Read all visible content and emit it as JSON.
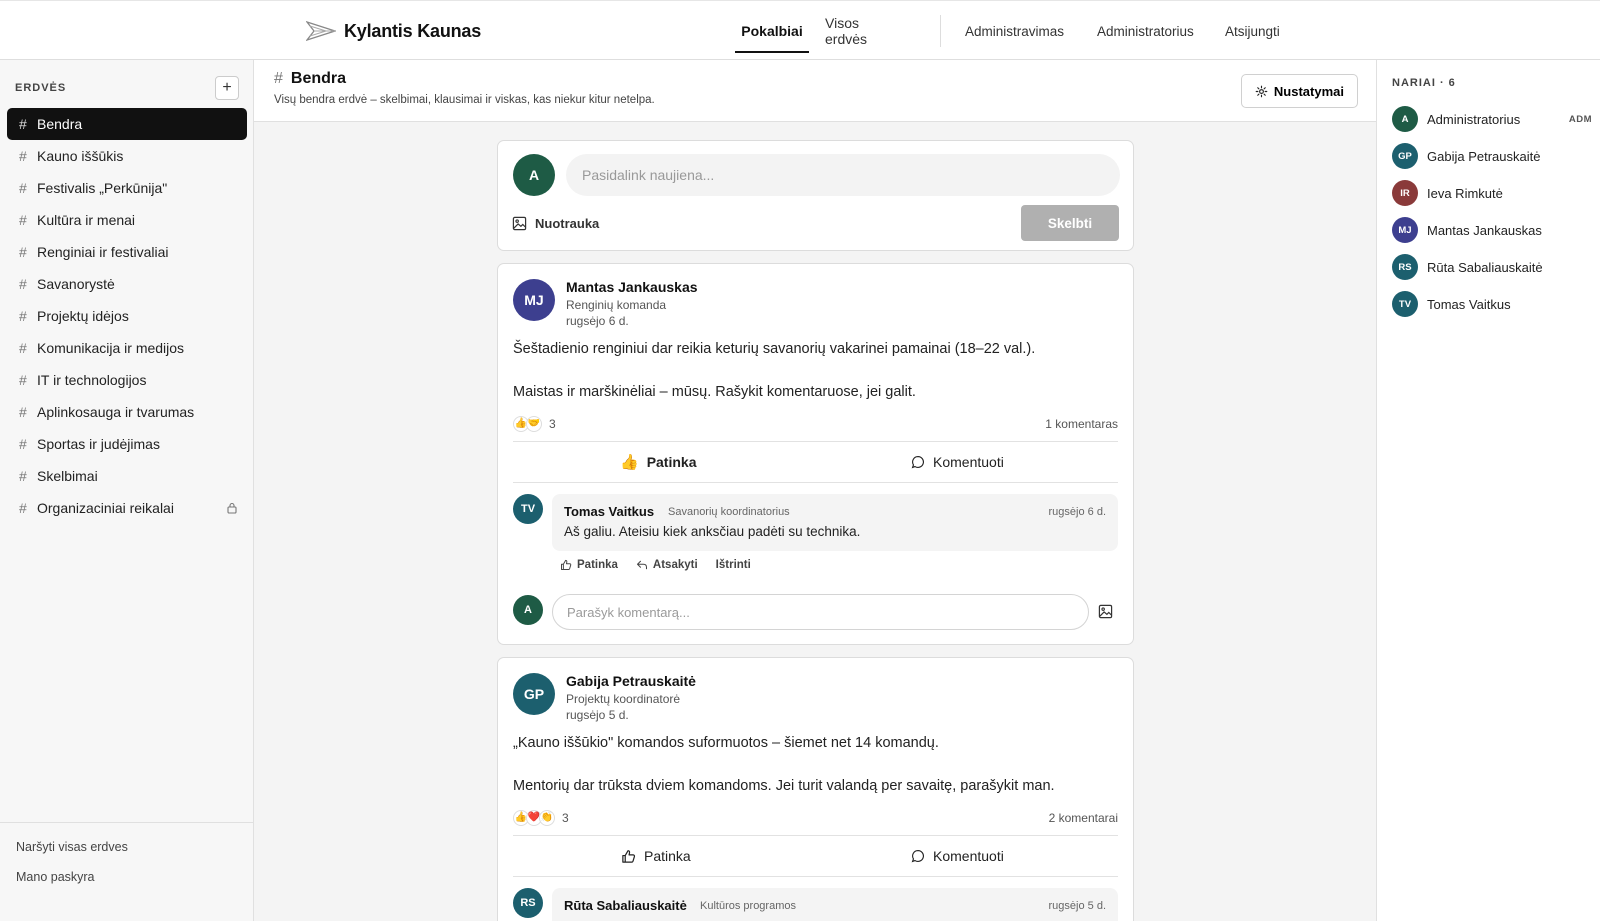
{
  "brand": {
    "name": "Kylantis Kaunas"
  },
  "nav": {
    "tabs": [
      {
        "label": "Pokalbiai",
        "active": true
      },
      {
        "label": "Visos erdvės",
        "active": false
      }
    ],
    "links": [
      "Administravimas",
      "Administratorius",
      "Atsijungti"
    ]
  },
  "sidebar": {
    "title": "ERDVĖS",
    "add_label": "+",
    "channels": [
      {
        "name": "Bendra",
        "active": true
      },
      {
        "name": "Kauno iššūkis"
      },
      {
        "name": "Festivalis „Perkūnija\""
      },
      {
        "name": "Kultūra ir menai"
      },
      {
        "name": "Renginiai ir festivaliai"
      },
      {
        "name": "Savanorystė"
      },
      {
        "name": "Projektų idėjos"
      },
      {
        "name": "Komunikacija ir medijos"
      },
      {
        "name": "IT ir technologijos"
      },
      {
        "name": "Aplinkosauga ir tvarumas"
      },
      {
        "name": "Sportas ir judėjimas"
      },
      {
        "name": "Skelbimai"
      },
      {
        "name": "Organizaciniai reikalai",
        "locked": true
      }
    ],
    "footer": {
      "browse": "Naršyti visas erdves",
      "account": "Mano paskyra"
    }
  },
  "channel": {
    "hash": "#",
    "title": "Bendra",
    "description": "Visų bendra erdvė – skelbimai, klausimai ir viskas, kas niekur kitur netelpa.",
    "settings_label": "Nustatymai"
  },
  "composer": {
    "avatar": "A",
    "placeholder": "Pasidalink naujiena...",
    "photo_label": "Nuotrauka",
    "post_label": "Skelbti"
  },
  "posts": [
    {
      "initials": "MJ",
      "author": "Mantas Jankauskas",
      "role": "Renginių komanda",
      "date": "rugsėjo 6 d.",
      "paragraphs": [
        "Šeštadienio renginiui dar reikia keturių savanorių vakarinei pamainai (18–22 val.).",
        "Maistas ir marškinėliai – mūsų. Rašykit komentaruose, jei galit."
      ],
      "reactions": [
        "👍",
        "🤝"
      ],
      "reaction_count": "3",
      "comment_count": "1 komentaras",
      "like_label": "Patinka",
      "comment_label": "Komentuoti",
      "comment": {
        "initials": "TV",
        "author": "Tomas Vaitkus",
        "role": "Savanorių koordinatorius",
        "date": "rugsėjo 6 d.",
        "text": "Aš galiu. Ateisiu kiek anksčiau padėti su technika.",
        "actions": [
          "Patinka",
          "Atsakyti",
          "Ištrinti"
        ]
      },
      "reply": {
        "avatar": "A",
        "placeholder": "Parašyk komentarą..."
      }
    },
    {
      "initials": "GP",
      "author": "Gabija Petrauskaitė",
      "role": "Projektų koordinatorė",
      "date": "rugsėjo 5 d.",
      "paragraphs": [
        "„Kauno iššūkio\" komandos suformuotos – šiemet net 14 komandų.",
        "Mentorių dar trūksta dviem komandoms. Jei turit valandą per savaitę, parašykit man."
      ],
      "reactions": [
        "👍",
        "❤️",
        "👏"
      ],
      "reaction_count": "3",
      "comment_count": "2 komentarai",
      "like_label": "Patinka",
      "comment_label": "Komentuoti",
      "comment": {
        "initials": "RS",
        "author": "Rūta Sabaliauskaitė",
        "role": "Kultūros programos",
        "date": "rugsėjo 5 d."
      }
    }
  ],
  "members": {
    "title": "NARIAI · 6",
    "list": [
      {
        "initials": "A",
        "name": "Administratorius",
        "badge": "ADM",
        "color": "#1e5b45"
      },
      {
        "initials": "GP",
        "name": "Gabija Petrauskaitė",
        "color": "#1c5f6e"
      },
      {
        "initials": "IR",
        "name": "Ieva Rimkutė",
        "color": "#8a3a3a"
      },
      {
        "initials": "MJ",
        "name": "Mantas Jankauskas",
        "color": "#3d3f8f"
      },
      {
        "initials": "RS",
        "name": "Rūta Sabaliauskaitė",
        "color": "#1c5f6e"
      },
      {
        "initials": "TV",
        "name": "Tomas Vaitkus",
        "color": "#1c5f6e"
      }
    ]
  },
  "colors": {
    "admin_green": "#1e5b45",
    "teal": "#1c5f6e",
    "indigo": "#3d3f8f",
    "maroon": "#8a3a3a",
    "active_channel": "#111111"
  }
}
